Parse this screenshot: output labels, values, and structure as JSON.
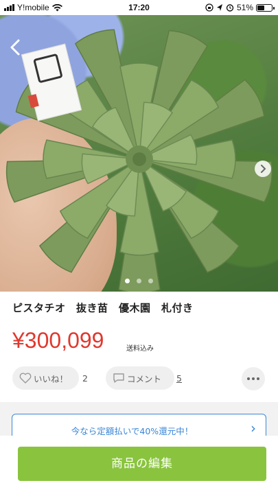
{
  "status_bar": {
    "carrier": "Y!mobile",
    "time": "17:20",
    "battery": "51%",
    "battery_level": 0.51,
    "icons": [
      "signal-icon",
      "wifi-icon",
      "orientation-lock-icon",
      "location-icon",
      "alarm-icon",
      "battery-icon"
    ]
  },
  "product": {
    "title": "ピスタチオ　抜き苗　優木園　札付き",
    "price": "¥300,099",
    "price_note": "送料込み",
    "image_count": 3,
    "current_image": 1
  },
  "actions": {
    "like_label": "いいね！",
    "like_count": "2",
    "comment_label": "コメント",
    "comment_count": "5"
  },
  "promo": {
    "text": "今なら定額払いで40%還元中！"
  },
  "bottom": {
    "edit_label": "商品の編集"
  },
  "colors": {
    "price": "#e0382e",
    "accent_green": "#8ac43f",
    "link_blue": "#3a86d6"
  }
}
